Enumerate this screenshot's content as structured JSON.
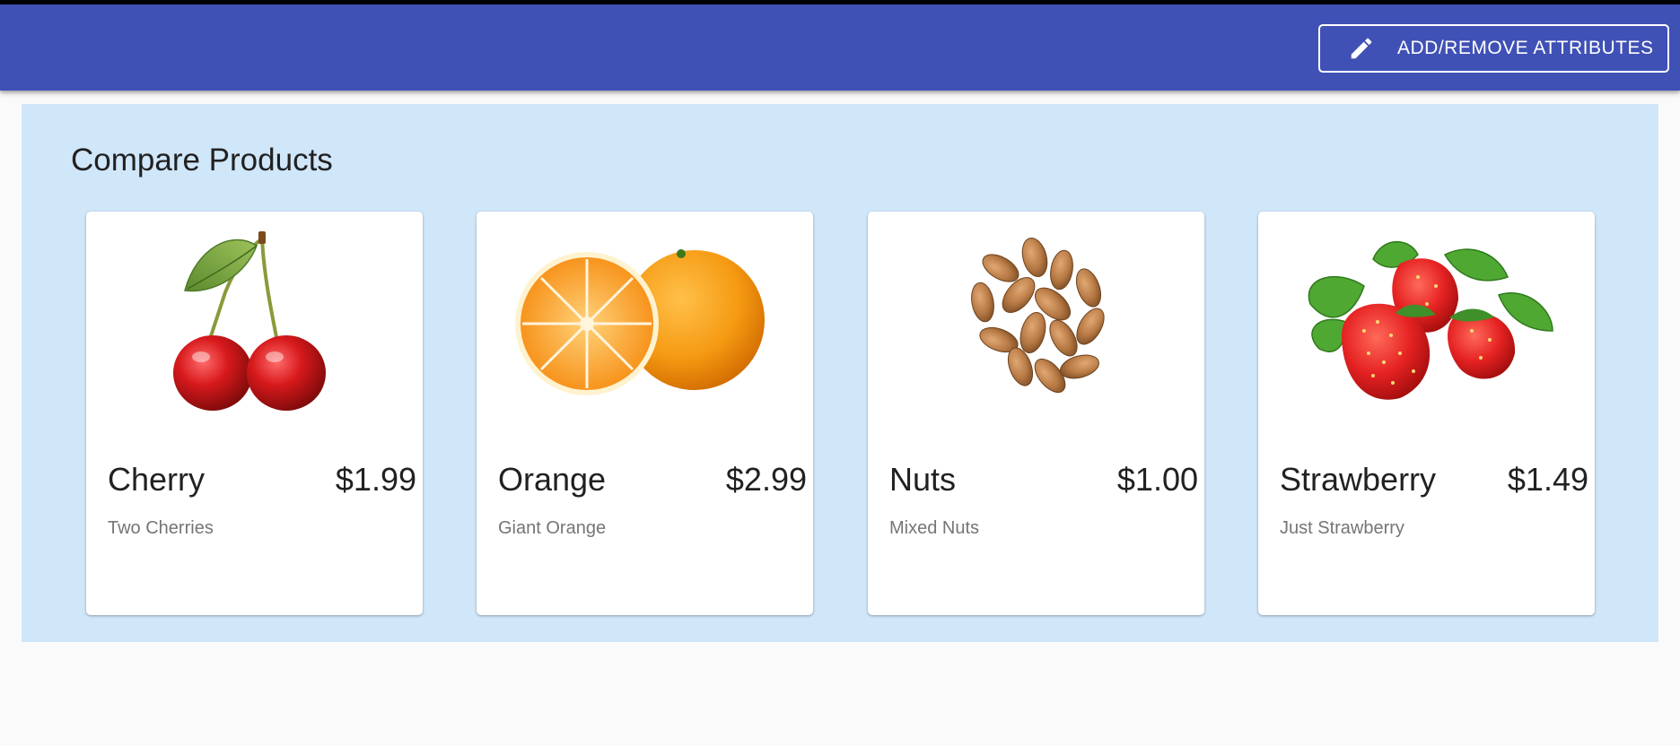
{
  "header": {
    "attributes_button_label": "ADD/REMOVE ATTRIBUTES",
    "attributes_button_icon": "pencil-icon",
    "background_color": "#3f51b5"
  },
  "compare": {
    "title": "Compare Products",
    "background_color": "#d0e6f9",
    "products": [
      {
        "name": "Cherry",
        "price": "$1.99",
        "description": "Two Cherries",
        "image": "cherry-image"
      },
      {
        "name": "Orange",
        "price": "$2.99",
        "description": "Giant Orange",
        "image": "orange-image"
      },
      {
        "name": "Nuts",
        "price": "$1.00",
        "description": "Mixed Nuts",
        "image": "nuts-image"
      },
      {
        "name": "Strawberry",
        "price": "$1.49",
        "description": "Just Strawberry",
        "image": "strawberry-image"
      }
    ]
  }
}
